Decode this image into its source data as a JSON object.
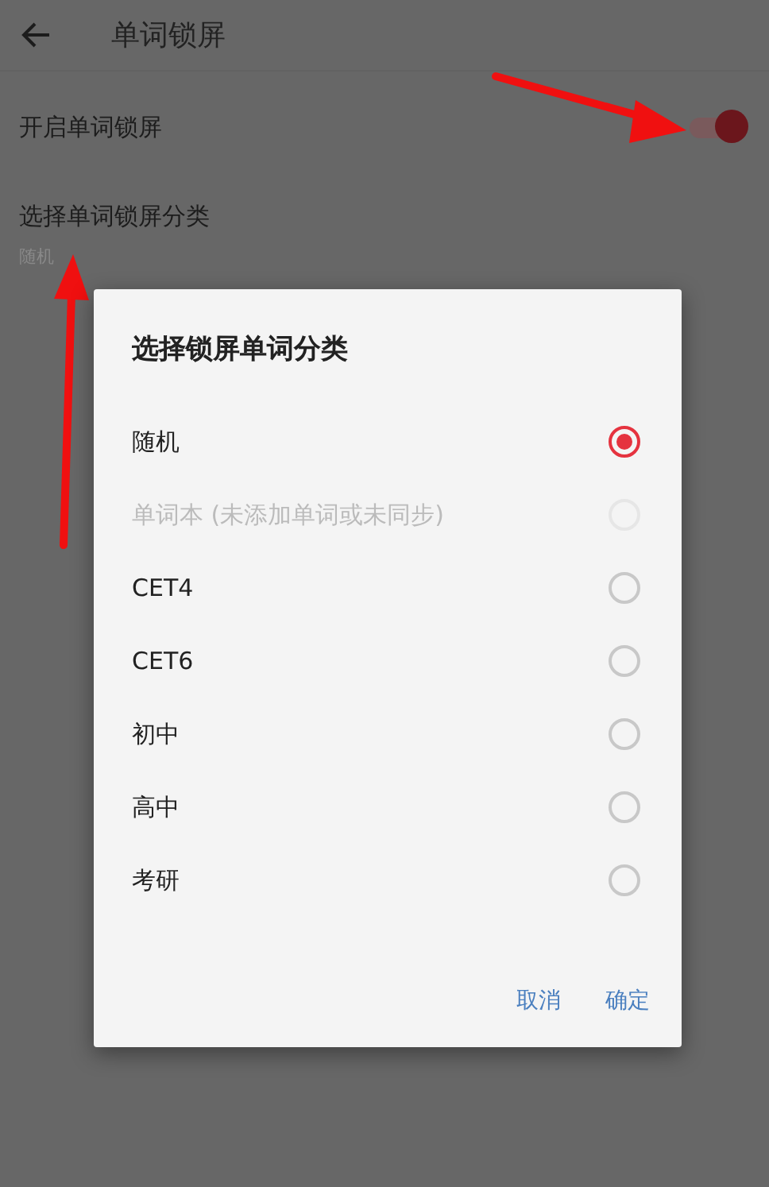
{
  "toolbar": {
    "title": "单词锁屏"
  },
  "settings": [
    {
      "kind": "switch",
      "title": "开启单词锁屏",
      "on": true
    },
    {
      "kind": "choice",
      "title": "选择单词锁屏分类",
      "summary": "随机"
    }
  ],
  "dialog": {
    "title": "选择锁屏单词分类",
    "options": [
      {
        "label": "随机",
        "selected": true,
        "disabled": false
      },
      {
        "label": "单词本 (未添加单词或未同步)",
        "selected": false,
        "disabled": true
      },
      {
        "label": "CET4",
        "selected": false,
        "disabled": false
      },
      {
        "label": "CET6",
        "selected": false,
        "disabled": false
      },
      {
        "label": "初中",
        "selected": false,
        "disabled": false
      },
      {
        "label": "高中",
        "selected": false,
        "disabled": false
      },
      {
        "label": "考研",
        "selected": false,
        "disabled": false
      }
    ],
    "buttons": [
      "取消",
      "确定"
    ]
  }
}
